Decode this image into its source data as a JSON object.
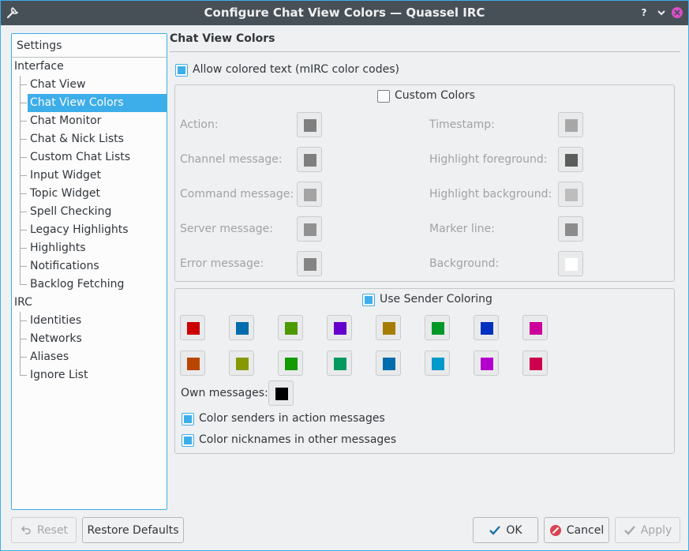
{
  "window": {
    "title": "Configure Chat View Colors — Quassel IRC",
    "help_glyph": "?"
  },
  "tree": {
    "header": "Settings",
    "groups": [
      {
        "label": "Interface",
        "items": [
          "Chat View",
          "Chat View Colors",
          "Chat Monitor",
          "Chat & Nick Lists",
          "Custom Chat Lists",
          "Input Widget",
          "Topic Widget",
          "Spell Checking",
          "Legacy Highlights",
          "Highlights",
          "Notifications",
          "Backlog Fetching"
        ]
      },
      {
        "label": "IRC",
        "items": [
          "Identities",
          "Networks",
          "Aliases",
          "Ignore List"
        ]
      }
    ],
    "selected": "Chat View Colors"
  },
  "page": {
    "title": "Chat View Colors",
    "allow_colored_text": {
      "label": "Allow colored text (mIRC color codes)",
      "checked": true
    },
    "custom_colors": {
      "label": "Custom Colors",
      "checked": false,
      "left": [
        {
          "label": "Action:",
          "color": "#7f7f7f"
        },
        {
          "label": "Channel message:",
          "color": "#7f7f7f"
        },
        {
          "label": "Command message:",
          "color": "#a4a4a4"
        },
        {
          "label": "Server message:",
          "color": "#919191"
        },
        {
          "label": "Error message:",
          "color": "#848484"
        }
      ],
      "right": [
        {
          "label": "Timestamp:",
          "color": "#a8a8a8"
        },
        {
          "label": "Highlight foreground:",
          "color": "#5d5d5d"
        },
        {
          "label": "Highlight background:",
          "color": "#bdbdbd"
        },
        {
          "label": "Marker line:",
          "color": "#8c8c8c"
        },
        {
          "label": "Background:",
          "color": "#ffffff"
        }
      ]
    },
    "sender_coloring": {
      "label": "Use Sender Coloring",
      "checked": true,
      "colors_row1": [
        "#cc0000",
        "#006cad",
        "#4d9900",
        "#6600cc",
        "#a67d00",
        "#009927",
        "#0030c0",
        "#cc009a"
      ],
      "colors_row2": [
        "#b94600",
        "#869900",
        "#149900",
        "#009960",
        "#006cad",
        "#0099cc",
        "#b300cc",
        "#cc004d"
      ],
      "own_messages": {
        "label": "Own messages:",
        "color": "#000000"
      },
      "action_messages": {
        "label": "Color senders in action messages",
        "checked": true
      },
      "other_messages": {
        "label": "Color nicknames in other messages",
        "checked": true
      }
    }
  },
  "buttons": {
    "reset": "Reset",
    "restore_defaults": "Restore Defaults",
    "ok": "OK",
    "cancel": "Cancel",
    "apply": "Apply"
  }
}
